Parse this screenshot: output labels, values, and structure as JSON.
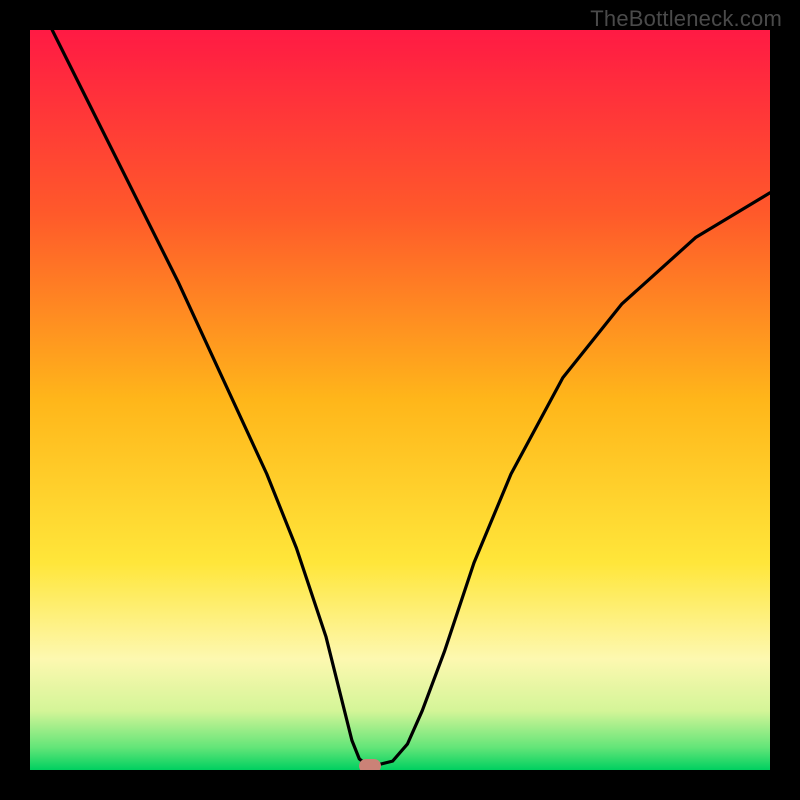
{
  "watermark": "TheBottleneck.com",
  "chart_data": {
    "type": "line",
    "title": "",
    "xlabel": "",
    "ylabel": "",
    "xlim": [
      0,
      100
    ],
    "ylim": [
      0,
      100
    ],
    "series": [
      {
        "name": "curve",
        "x": [
          3,
          8,
          14,
          20,
          26,
          32,
          36,
          40,
          42,
          43.5,
          44.5,
          45.5,
          47.0,
          49.0,
          51.0,
          53.0,
          56.0,
          60.0,
          65.0,
          72.0,
          80.0,
          90.0,
          100.0
        ],
        "y": [
          100,
          90,
          78,
          66,
          53,
          40,
          30,
          18,
          10,
          4,
          1.5,
          0.7,
          0.7,
          1.2,
          3.5,
          8,
          16,
          28,
          40,
          53,
          63,
          72,
          78
        ]
      }
    ],
    "marker": {
      "x": 46,
      "y": 0.5
    },
    "gradient_stops": [
      {
        "offset": 0,
        "color": "#ff1a44"
      },
      {
        "offset": 25,
        "color": "#ff5a2a"
      },
      {
        "offset": 50,
        "color": "#ffb61a"
      },
      {
        "offset": 72,
        "color": "#ffe63a"
      },
      {
        "offset": 85,
        "color": "#fdf8b0"
      },
      {
        "offset": 92,
        "color": "#d4f598"
      },
      {
        "offset": 97,
        "color": "#62e578"
      },
      {
        "offset": 100,
        "color": "#00d060"
      }
    ]
  }
}
